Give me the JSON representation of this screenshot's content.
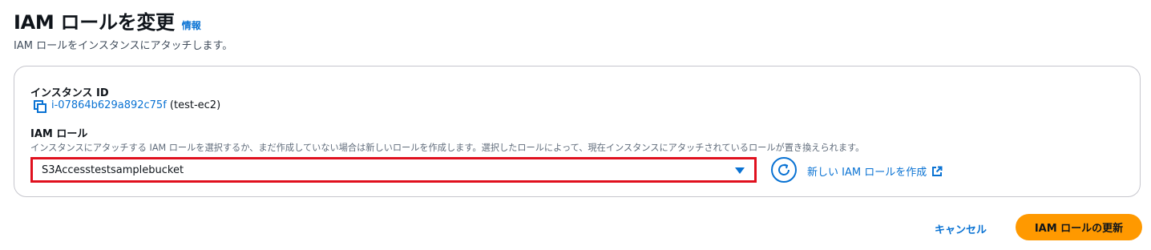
{
  "header": {
    "title": "IAM ロールを変更",
    "info_link": "情報",
    "description": "IAM ロールをインスタンスにアタッチします。"
  },
  "instance": {
    "label": "インスタンス ID",
    "id": "i-07864b629a892c75f",
    "name": "(test-ec2)",
    "copy_icon": "copy-icon"
  },
  "iam_role": {
    "label": "IAM ロール",
    "description": "インスタンスにアタッチする IAM ロールを選択するか、まだ作成していない場合は新しいロールを作成します。選択したロールによって、現在インスタンスにアタッチされているロールが置き換えられます。",
    "selected_value": "S3Accesstestsamplebucket",
    "refresh_icon": "refresh-icon",
    "create_link": "新しい IAM ロールを作成",
    "external_icon": "external-link-icon"
  },
  "actions": {
    "cancel": "キャンセル",
    "submit": "IAM ロールの更新"
  },
  "colors": {
    "link": "#0972d3",
    "primary_button": "#ff9900",
    "highlight_border": "#e0101e"
  }
}
